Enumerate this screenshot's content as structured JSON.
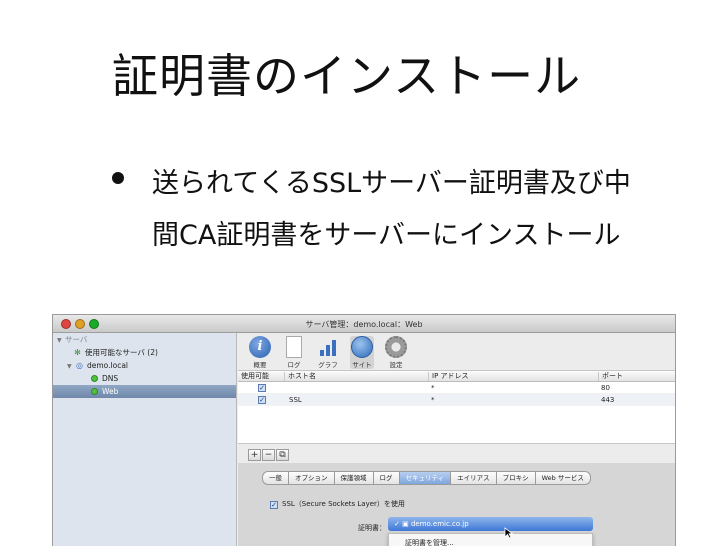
{
  "slide": {
    "title": "証明書のインストール",
    "bullet": "送られてくるSSLサーバー証明書及び中間CA証明書をサーバーにインストール"
  },
  "window": {
    "title": "サーバ管理：demo.local：Web",
    "traffic_colors": {
      "close": "#e0443e",
      "minimize": "#dea123",
      "zoom": "#1aab29"
    }
  },
  "sidebar": {
    "header": "サーバ",
    "items": [
      {
        "label": "使用可能なサーバ (2)",
        "icon": "globe-icon"
      },
      {
        "label": "demo.local",
        "icon": "server-icon"
      },
      {
        "label": "DNS",
        "icon": "status-led-icon"
      },
      {
        "label": "Web",
        "icon": "status-led-icon"
      }
    ]
  },
  "toolbar": {
    "items": [
      {
        "label": "概要",
        "icon": "info-icon"
      },
      {
        "label": "ログ",
        "icon": "document-icon"
      },
      {
        "label": "グラフ",
        "icon": "bar-graph-icon"
      },
      {
        "label": "サイト",
        "icon": "globe-icon"
      },
      {
        "label": "設定",
        "icon": "gear-icon"
      }
    ]
  },
  "table": {
    "headers": [
      "使用可能",
      "ホスト名",
      "IP アドレス",
      "ポート"
    ],
    "rows": [
      {
        "enabled": true,
        "host": "",
        "ip": "*",
        "port": "80"
      },
      {
        "enabled": true,
        "host": "SSL",
        "ip": "*",
        "port": "443"
      }
    ]
  },
  "buttons": {
    "add": "+",
    "remove": "−",
    "edit": "⧉"
  },
  "tabs": [
    {
      "label": "一般",
      "selected": false
    },
    {
      "label": "オプション",
      "selected": false
    },
    {
      "label": "保護領域",
      "selected": false
    },
    {
      "label": "ログ",
      "selected": false
    },
    {
      "label": "セキュリティ",
      "selected": true
    },
    {
      "label": "エイリアス",
      "selected": false
    },
    {
      "label": "プロキシ",
      "selected": false
    },
    {
      "label": "Web サービス",
      "selected": false
    }
  ],
  "ssl": {
    "checkbox_label": "SSL（Secure Sockets Layer）を使用",
    "cert_label": "証明書：",
    "selected_cert": "demo.emic.co.jp",
    "menu_item": "証明書を管理..."
  }
}
